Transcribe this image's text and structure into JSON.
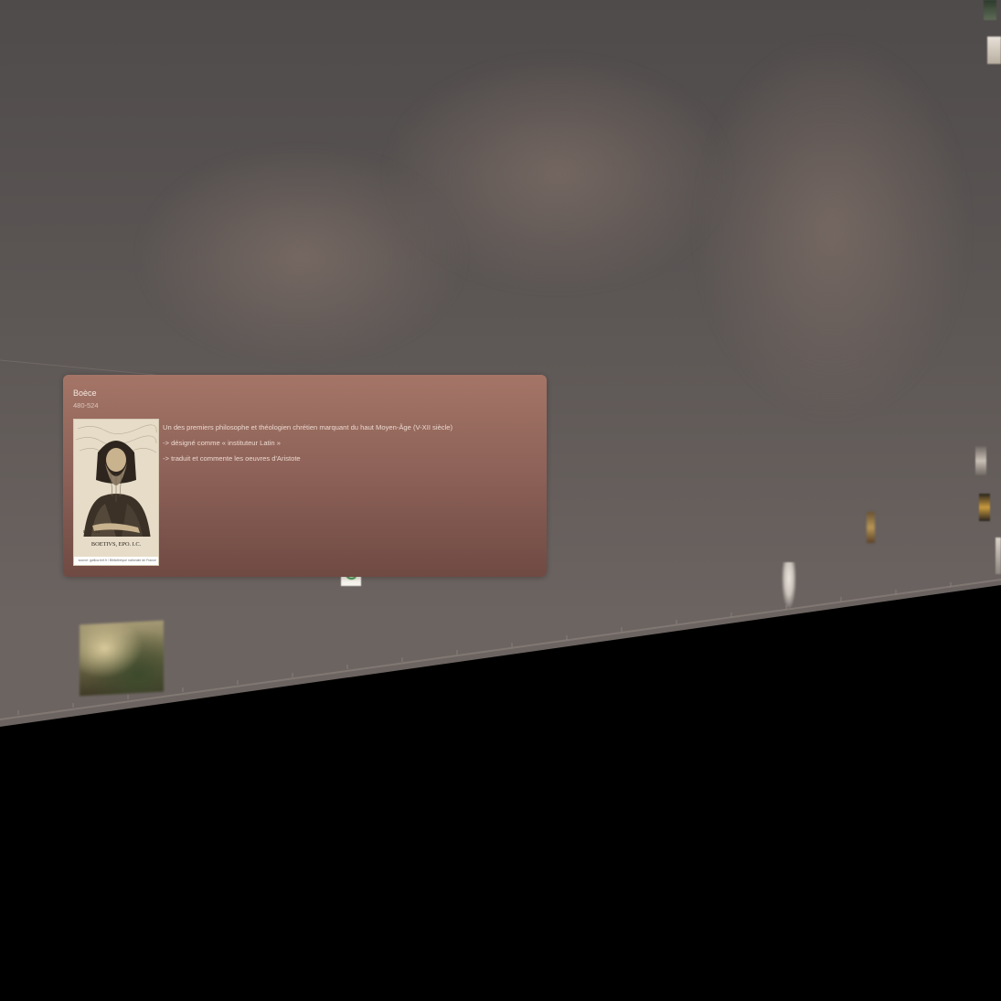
{
  "event_card": {
    "title": "Boèce",
    "dates": "480-524",
    "portrait_caption": "BOETIVS, EPO. I.C.",
    "portrait_credit": "source: gallica.bnf.fr / Bibliothèque nationale de France",
    "description_lines": [
      "Un des premiers philosophe et théologien chrétien marquant du haut Moyen-Âge (V-XII siècle)",
      "-> désigné comme « instituteur Latin »",
      "-> traduit et commente les oeuvres d'Aristote"
    ]
  },
  "background_events": {
    "left_label": "",
    "painting": {
      "title": "",
      "dates": "",
      "desc": ""
    },
    "center_lines": [
      "",
      "",
      ""
    ],
    "mid_title": "",
    "mid_lines": [
      "",
      ""
    ],
    "statue_text": "",
    "right_text": ""
  },
  "colors": {
    "card_top": "#a47567",
    "card_bottom": "#6f4a43",
    "timeline_surface": "#5e5856",
    "void": "#000000"
  }
}
